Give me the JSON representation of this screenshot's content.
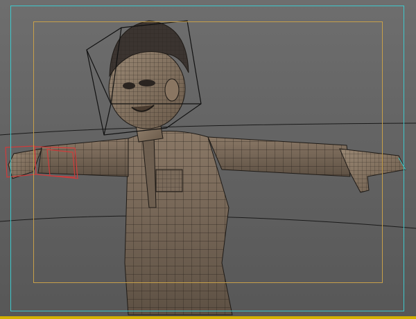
{
  "viewport": {
    "label": "",
    "background_top": "#6c6c6c",
    "background_bottom": "#575757",
    "safe_frame_outer_color": "#3fc8cc",
    "safe_frame_inner_color": "#c8a04a",
    "selection_color": "#d23a3a",
    "bounding_box_color": "#111111",
    "mesh_fill": "#7a6b5a",
    "mesh_wire": "#2a241e",
    "hair_fill": "#3b3430"
  }
}
